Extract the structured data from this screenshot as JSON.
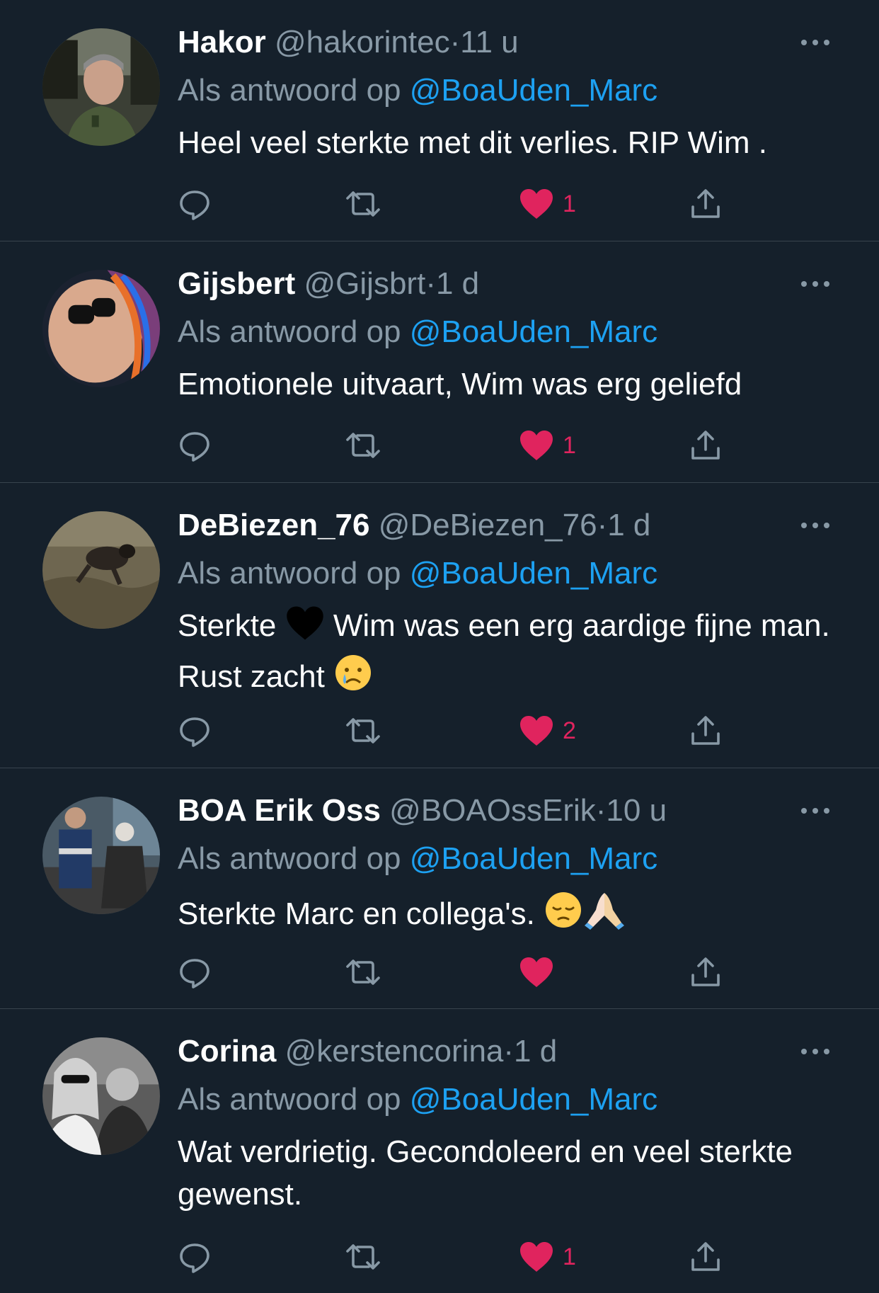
{
  "colors": {
    "background": "#15202b",
    "divider": "#38444d",
    "secondary_text": "#8899a6",
    "mention": "#1da1f2",
    "like": "#e0245e"
  },
  "tweets": [
    {
      "name": "Hakor",
      "handle": "@hakorintec",
      "separator": "·",
      "time": "11 u",
      "replying_prefix": "Als antwoord op",
      "replying_to": "@BoaUden_Marc",
      "text_parts": [
        "Heel veel sterkte met dit verlies.  RIP Wim ."
      ],
      "emojis": [],
      "liked": true,
      "like_count": "1",
      "avatar_icon": "avatar-man-in-car-photo"
    },
    {
      "name": "Gijsbert",
      "handle": "@Gijsbrt",
      "separator": "·",
      "time": "1 d",
      "replying_prefix": "Als antwoord op",
      "replying_to": "@BoaUden_Marc",
      "text_parts": [
        "Emotionele uitvaart, Wim was erg geliefd"
      ],
      "emojis": [],
      "liked": true,
      "like_count": "1",
      "avatar_icon": "avatar-sunglasses-beanie-photo"
    },
    {
      "name": "DeBiezen_76",
      "handle": "@DeBiezen_76",
      "separator": "·",
      "time": "1 d",
      "replying_prefix": "Als antwoord op",
      "replying_to": "@BoaUden_Marc",
      "text_parts": [
        "Sterkte ",
        " Wim was een erg aardige fijne man. Rust zacht "
      ],
      "emojis": [
        "black-heart-emoji",
        "crying-face-emoji"
      ],
      "liked": true,
      "like_count": "2",
      "avatar_icon": "avatar-mud-photo"
    },
    {
      "name": "BOA Erik Oss",
      "handle": "@BOAOssErik",
      "separator": "·",
      "time": "10 u",
      "replying_prefix": "Als antwoord op",
      "replying_to": "@BoaUden_Marc",
      "text_parts": [
        "Sterkte Marc en collega's. "
      ],
      "emojis": [
        "pensive-face-emoji",
        "folded-hands-emoji"
      ],
      "liked": true,
      "like_count": "",
      "avatar_icon": "avatar-officers-photo"
    },
    {
      "name": "Corina",
      "handle": "@kerstencorina",
      "separator": "·",
      "time": "1 d",
      "replying_prefix": "Als antwoord op",
      "replying_to": "@BoaUden_Marc",
      "text_parts": [
        "Wat verdrietig. Gecondoleerd en veel sterkte gewenst."
      ],
      "emojis": [],
      "liked": true,
      "like_count": "1",
      "avatar_icon": "avatar-couple-bw-photo"
    }
  ]
}
